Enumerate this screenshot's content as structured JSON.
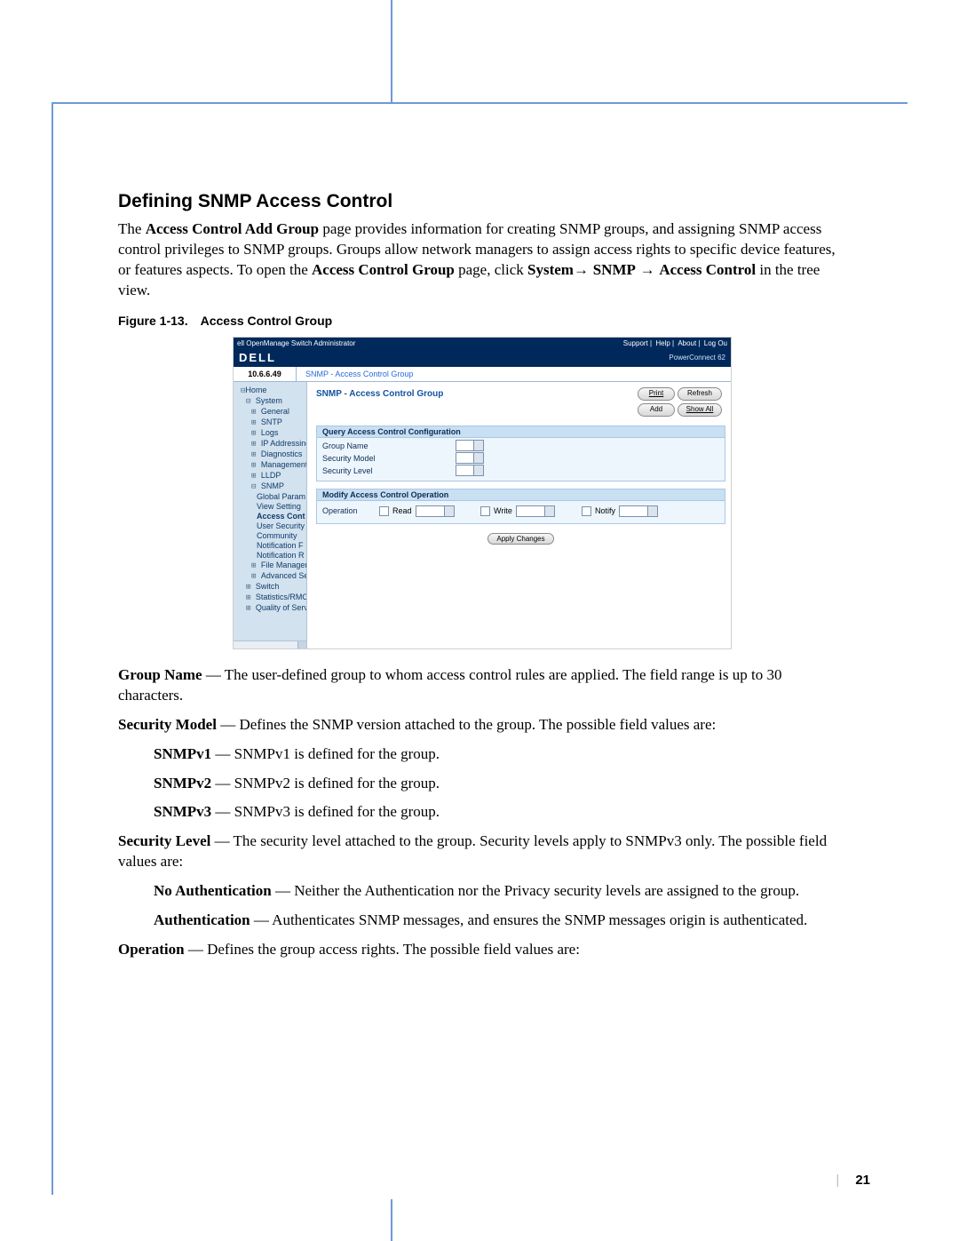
{
  "section_title": "Defining SNMP Access Control",
  "intro": {
    "p1_a": "The ",
    "p1_b": "Access Control Add Group",
    "p1_c": " page provides information for creating SNMP groups, and assigning SNMP access control privileges to SNMP groups. Groups allow network managers to assign access rights to specific device features, or features aspects. To open the ",
    "p1_d": "Access Control Group",
    "p1_e": " page, click ",
    "p1_f": "System",
    "p1_g": "→ ",
    "p1_h": "SNMP",
    "p1_i": " → ",
    "p1_j": "Access Control",
    "p1_k": " in the tree view."
  },
  "figure_caption_prefix": "Figure 1-13.",
  "figure_caption_title": "Access Control Group",
  "shot": {
    "topbar_left": "ell OpenManage Switch Administrator",
    "topbar_links": [
      "Support",
      "Help",
      "About",
      "Log Ou"
    ],
    "logo": "DELL",
    "product": "PowerConnect 62",
    "ip": "10.6.6.49",
    "breadcrumb": "SNMP - Access Control Group",
    "page_title": "SNMP - Access Control Group",
    "buttons": {
      "print": "Print",
      "refresh": "Refresh",
      "add": "Add",
      "showall": "Show All"
    },
    "band_query": "Query Access Control Configuration",
    "rows": {
      "group_name": "Group Name",
      "security_model": "Security Model",
      "security_level": "Security Level"
    },
    "band_modify": "Modify Access Control Operation",
    "operation_label": "Operation",
    "ops": {
      "read": "Read",
      "write": "Write",
      "notify": "Notify"
    },
    "apply": "Apply Changes",
    "tree": {
      "home": "Home",
      "system": "System",
      "general": "General",
      "sntp": "SNTP",
      "logs": "Logs",
      "ip": "IP Addressing",
      "diag": "Diagnostics",
      "mgmt": "Management Se",
      "lldp": "LLDP",
      "snmp": "SNMP",
      "global": "Global Param",
      "view": "View Setting",
      "access": "Access Cont",
      "usersec": "User Security",
      "community": "Community",
      "notif_f": "Notification F",
      "notif_r": "Notification R",
      "filemgr": "File Managemen",
      "adv": "Advanced Settin",
      "switch": "Switch",
      "stats": "Statistics/RMON",
      "qos": "Quality of Service"
    }
  },
  "defs": {
    "group_name_t": "Group Name",
    "group_name_b": " — The user-defined group to whom access control rules are applied. The field range is up to 30 characters.",
    "sec_model_t": "Security Model",
    "sec_model_b": " — Defines the SNMP version attached to the group. The possible field values are:",
    "v1_t": "SNMPv1",
    "v1_b": " — SNMPv1 is defined for the group.",
    "v2_t": "SNMPv2",
    "v2_b": " — SNMPv2 is defined for the group.",
    "v3_t": "SNMPv3",
    "v3_b": " — SNMPv3 is defined for the group.",
    "sec_level_t": "Security Level",
    "sec_level_b": " — The security level attached to the group. Security levels apply to SNMPv3 only. The possible field values are:",
    "noauth_t": "No Authentication",
    "noauth_b": " — Neither the Authentication nor the Privacy security levels are assigned to the group.",
    "auth_t": "Authentication",
    "auth_b": " — Authenticates SNMP messages, and ensures the SNMP messages origin is authenticated.",
    "op_t": "Operation",
    "op_b": " — Defines the group access rights. The possible field values are:"
  },
  "page_number": "21"
}
